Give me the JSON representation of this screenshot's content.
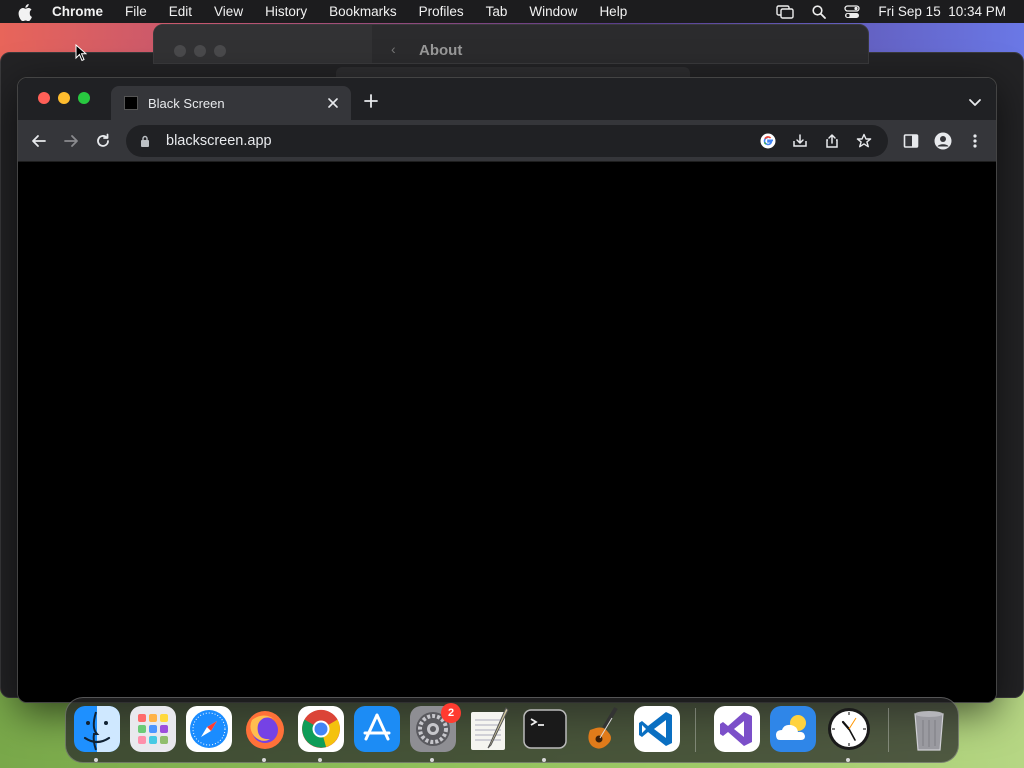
{
  "menubar": {
    "app_name": "Chrome",
    "items": [
      "File",
      "Edit",
      "View",
      "History",
      "Bookmarks",
      "Profiles",
      "Tab",
      "Window",
      "Help"
    ],
    "datetime": "Fri Sep 15  10:34 PM"
  },
  "background_window": {
    "title": "About"
  },
  "browser": {
    "tab_title": "Black Screen",
    "url": "blackscreen.app",
    "page_background": "#000000"
  },
  "dock": {
    "apps": [
      {
        "name": "Finder",
        "running": true
      },
      {
        "name": "Launchpad",
        "running": false
      },
      {
        "name": "Safari",
        "running": false
      },
      {
        "name": "Firefox",
        "running": true
      },
      {
        "name": "Chrome",
        "running": true
      },
      {
        "name": "App Store",
        "running": false
      },
      {
        "name": "System Settings",
        "running": true,
        "badge": "2"
      },
      {
        "name": "TextEdit",
        "running": false
      },
      {
        "name": "Terminal",
        "running": true
      },
      {
        "name": "GarageBand",
        "running": false
      },
      {
        "name": "Visual Studio Code",
        "running": false
      },
      {
        "name": "Visual Studio",
        "running": false
      },
      {
        "name": "Weather",
        "running": false
      },
      {
        "name": "Clock",
        "running": true
      },
      {
        "name": "Trash",
        "running": false
      }
    ]
  },
  "colors": {
    "menubar_bg": "#1c1c1e",
    "tabbar_bg": "#202124",
    "toolbar_bg": "#35363a",
    "badge_red": "#ff3b30"
  }
}
